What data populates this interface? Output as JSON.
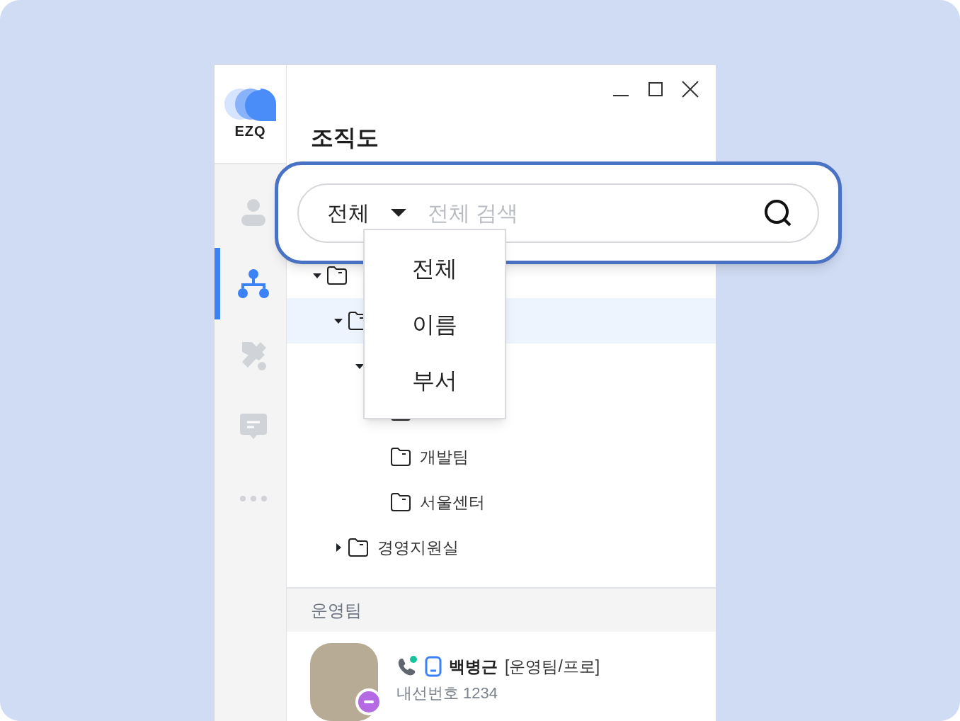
{
  "logo": {
    "text": "EZQ"
  },
  "sidebar": {
    "items": [
      {
        "kind": "person",
        "selected": false
      },
      {
        "kind": "org",
        "selected": true
      },
      {
        "kind": "tools",
        "selected": false
      },
      {
        "kind": "chat",
        "selected": false
      },
      {
        "kind": "more",
        "selected": false
      }
    ]
  },
  "window": {
    "title": "조직도"
  },
  "search": {
    "scope": "전체",
    "placeholder": "전체 검색",
    "menu": [
      "전체",
      "이름",
      "부서"
    ]
  },
  "tree": [
    {
      "expanded": true,
      "selected": false,
      "children": [
        {
          "expanded": true,
          "selected": true,
          "children": [
            {
              "expanded": true,
              "selected": false,
              "children": [
                {
                  "selected": false
                },
                {
                  "label": "개발팀",
                  "selected": false
                },
                {
                  "label": "서울센터",
                  "selected": false
                }
              ]
            }
          ]
        },
        {
          "label": "경영지원실",
          "expanded": false,
          "selected": false
        }
      ]
    }
  ],
  "section": {
    "title": "운영팀"
  },
  "people": [
    {
      "name": "백병근",
      "position": "[운영팀/프로]",
      "extension": "내선번호 1234",
      "phone_online": true,
      "color": "#b36ae2"
    }
  ]
}
